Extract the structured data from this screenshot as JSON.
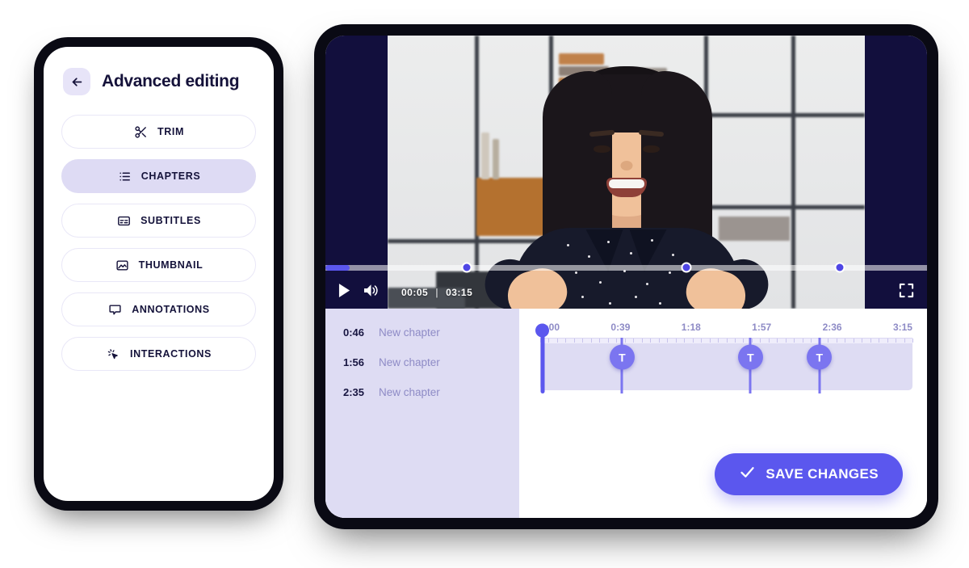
{
  "sidebar": {
    "back_icon": "arrow-left-icon",
    "title": "Advanced editing",
    "items": [
      {
        "label": "TRIM",
        "icon": "scissors-icon",
        "active": false
      },
      {
        "label": "CHAPTERS",
        "icon": "list-icon",
        "active": true
      },
      {
        "label": "SUBTITLES",
        "icon": "subtitles-icon",
        "active": false
      },
      {
        "label": "THUMBNAIL",
        "icon": "image-icon",
        "active": false
      },
      {
        "label": "ANNOTATIONS",
        "icon": "comment-icon",
        "active": false
      },
      {
        "label": "INTERACTIONS",
        "icon": "click-cursor-icon",
        "active": false
      }
    ]
  },
  "player": {
    "play_icon": "play-icon",
    "volume_icon": "volume-icon",
    "fullscreen_icon": "fullscreen-icon",
    "current_time": "00:05",
    "time_separator": "|",
    "duration": "03:15",
    "progress_percent": 4,
    "chapter_markers_percent": [
      23.5,
      60,
      85.5
    ]
  },
  "chapters": {
    "rows": [
      {
        "time": "0:46",
        "name": "New chapter"
      },
      {
        "time": "1:56",
        "name": "New chapter"
      },
      {
        "time": "2:35",
        "name": "New chapter"
      }
    ]
  },
  "timeline": {
    "tick_labels": [
      "0:00",
      "0:39",
      "1:18",
      "1:57",
      "2:36",
      "3:15"
    ],
    "playhead_percent": 0,
    "markers": [
      {
        "label": "T",
        "percent": 22
      },
      {
        "label": "T",
        "percent": 56.5
      },
      {
        "label": "T",
        "percent": 75
      }
    ]
  },
  "actions": {
    "save_label": "SAVE CHANGES",
    "save_icon": "check-icon"
  },
  "colors": {
    "accent": "#5B57EE",
    "accent_light": "#7B75F0",
    "lavender_panel": "#DEDCF3",
    "lavender_soft": "#EFEDFB",
    "dark_navy": "#120F3D",
    "text_dark": "#15123A",
    "text_muted": "#8E8BC6"
  }
}
